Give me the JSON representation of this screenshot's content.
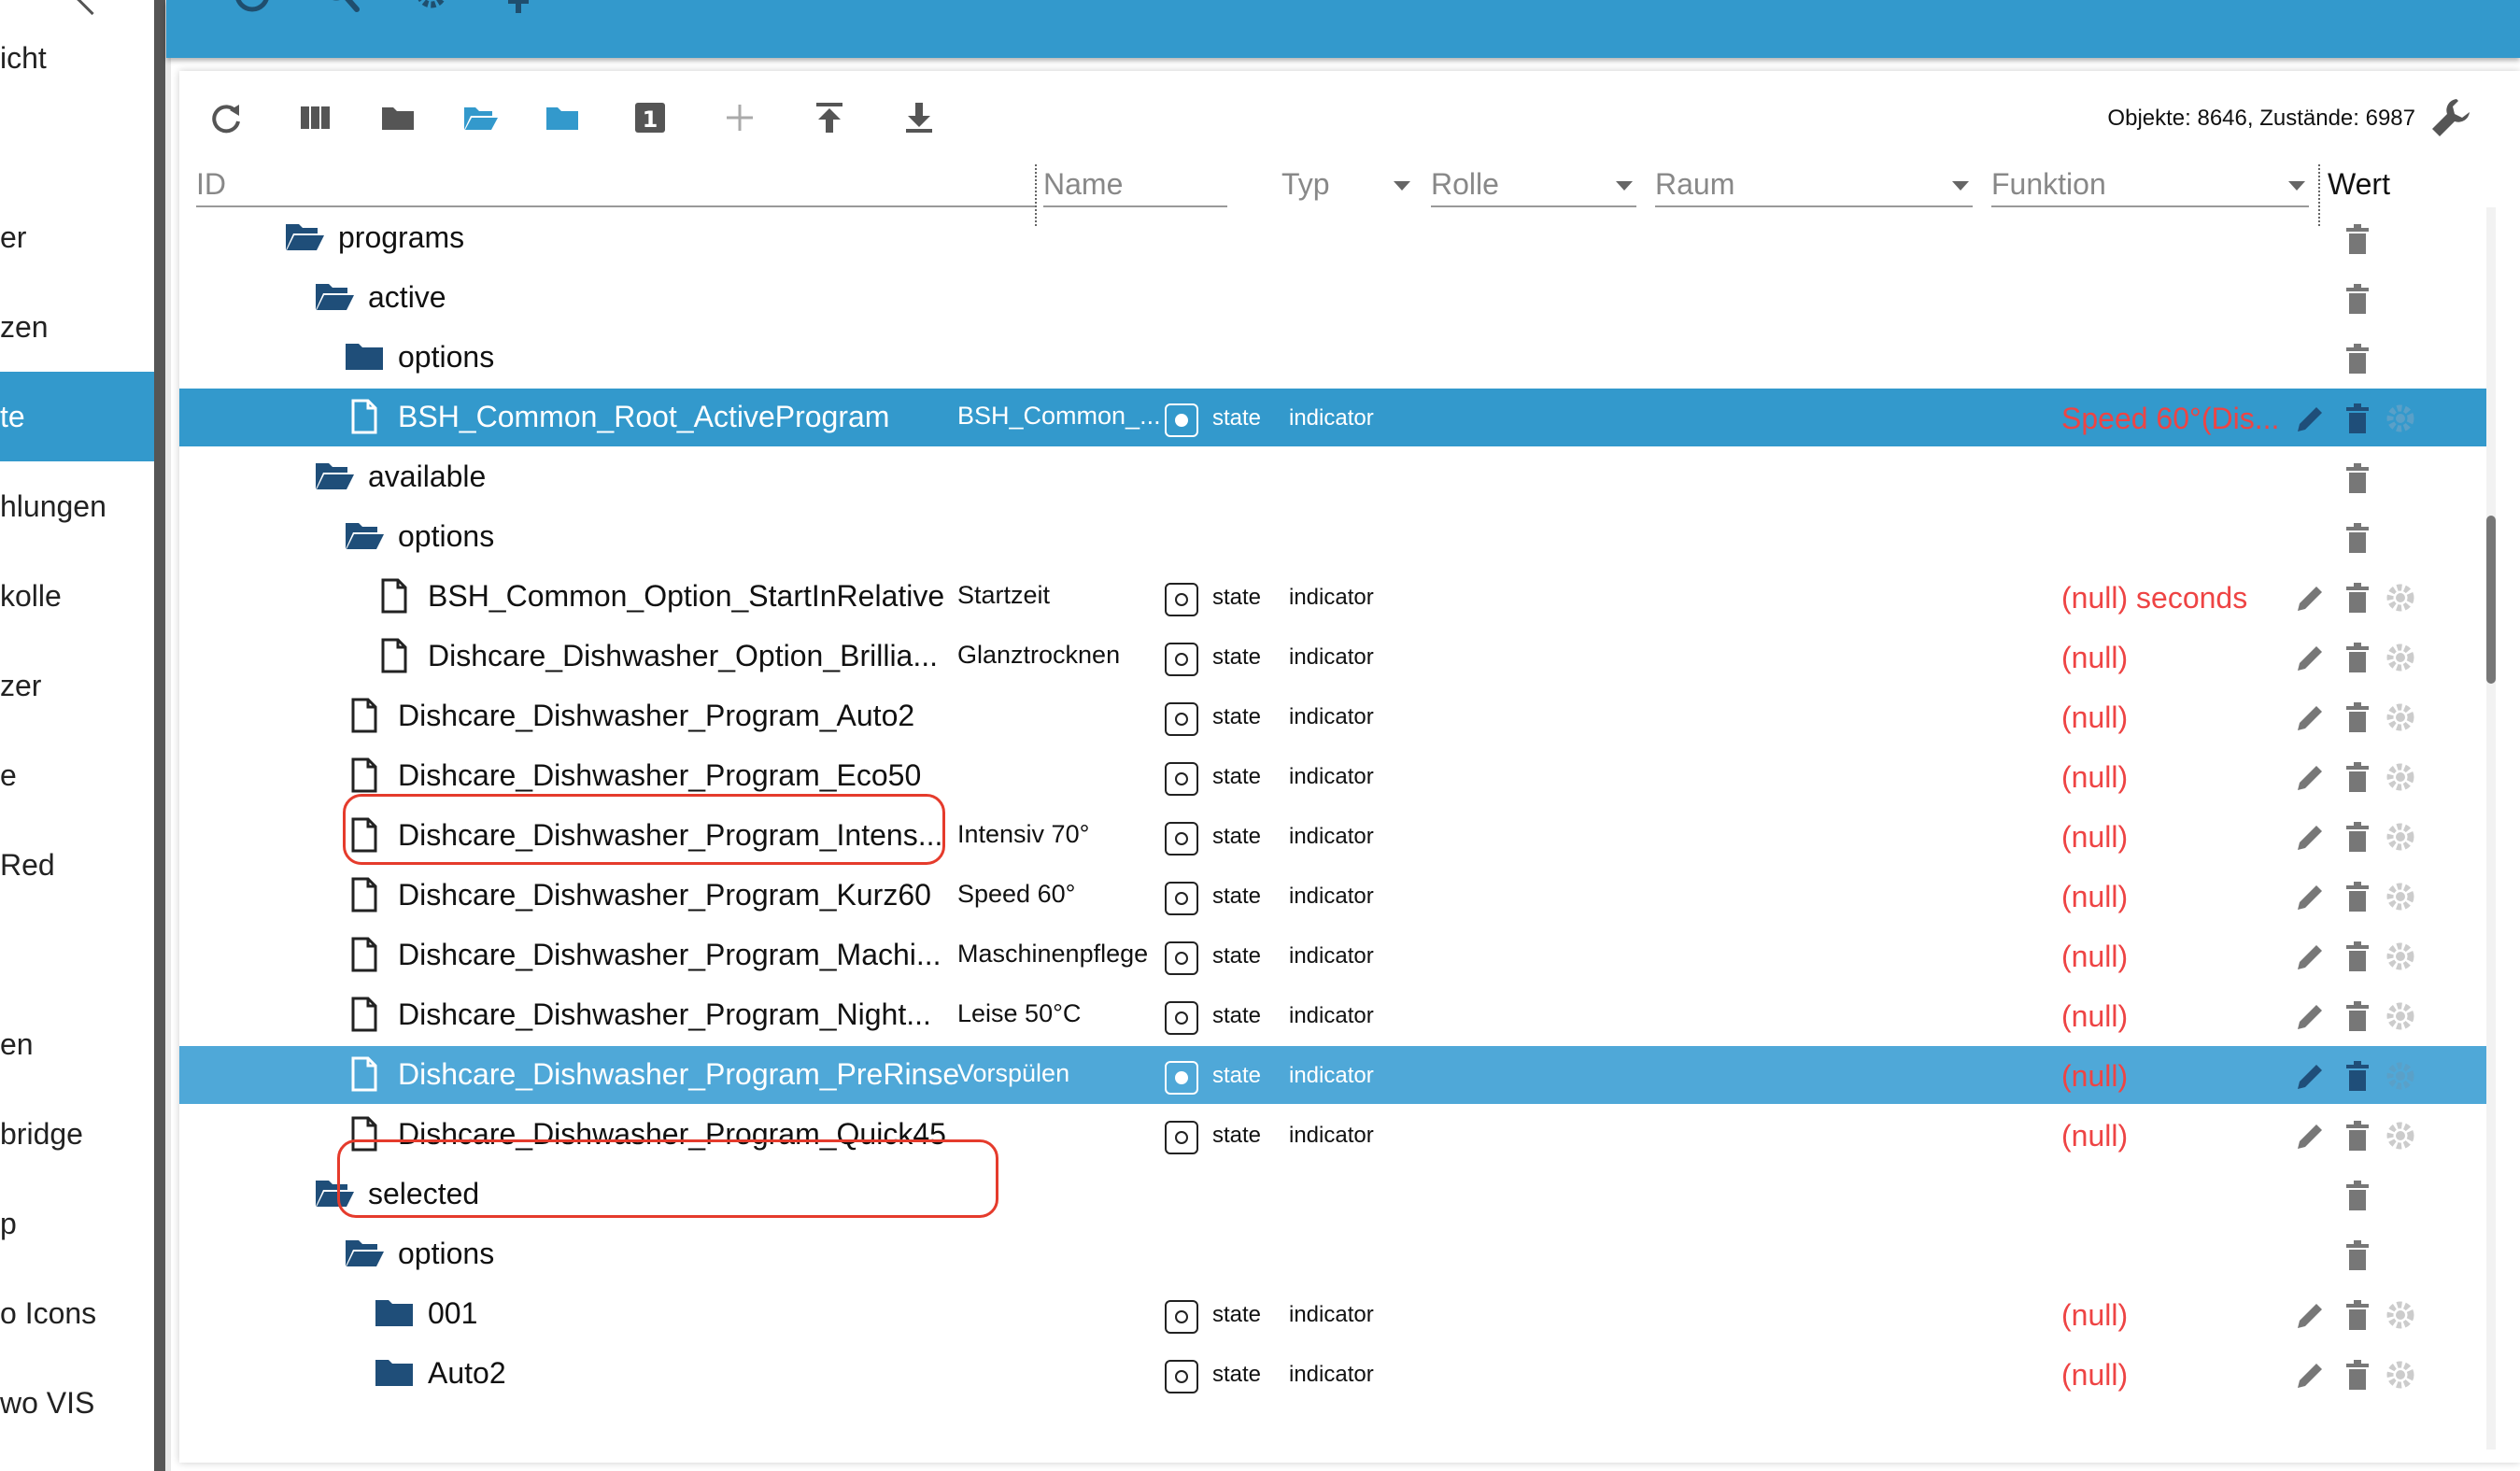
{
  "sidebar": {
    "items": [
      {
        "label": "icht",
        "active": false
      },
      {
        "label": "er",
        "active": false
      },
      {
        "label": "zen",
        "active": false
      },
      {
        "label": "te",
        "active": true
      },
      {
        "label": "hlungen",
        "active": false
      },
      {
        "label": "kolle",
        "active": false
      },
      {
        "label": "zer",
        "active": false
      },
      {
        "label": "e",
        "active": false
      },
      {
        "label": "Red",
        "active": false
      },
      {
        "label": "en",
        "active": false
      },
      {
        "label": "bridge",
        "active": false
      },
      {
        "label": "p",
        "active": false
      },
      {
        "label": "o Icons",
        "active": false
      },
      {
        "label": "wo VIS",
        "active": false
      }
    ]
  },
  "toolbar": {
    "counts": "Objekte: 8646, Zustände: 6987",
    "buttons": [
      "refresh-icon",
      "columns-icon",
      "folder-icon",
      "folder-open-icon",
      "folder-filled-icon",
      "number-one-icon",
      "add-icon",
      "upload-icon",
      "download-icon"
    ],
    "number_badge": "1"
  },
  "columns": {
    "id": "ID",
    "name": "Name",
    "typ": "Typ",
    "rolle": "Rolle",
    "raum": "Raum",
    "funktion": "Funktion",
    "wert": "Wert"
  },
  "rows": [
    {
      "icon": "folder-open",
      "indent": 1,
      "id": "programs",
      "name": "",
      "type": "",
      "role": "",
      "value": "",
      "actions": "delete"
    },
    {
      "icon": "folder-open",
      "indent": 2,
      "id": "active",
      "name": "",
      "type": "",
      "role": "",
      "value": "",
      "actions": "delete"
    },
    {
      "icon": "folder",
      "indent": 3,
      "id": "options",
      "name": "",
      "type": "",
      "role": "",
      "value": "",
      "actions": "delete"
    },
    {
      "icon": "file",
      "indent": 3,
      "id": "BSH_Common_Root_ActiveProgram",
      "name": "BSH_Common_...",
      "type": "state",
      "role": "indicator",
      "value": "Speed 60°(Dis...",
      "actions": "all",
      "selected": "sel",
      "typ_filled": true
    },
    {
      "icon": "folder-open",
      "indent": 2,
      "id": "available",
      "name": "",
      "type": "",
      "role": "",
      "value": "",
      "actions": "delete"
    },
    {
      "icon": "folder-open",
      "indent": 3,
      "id": "options",
      "name": "",
      "type": "",
      "role": "",
      "value": "",
      "actions": "delete"
    },
    {
      "icon": "file",
      "indent": 4,
      "id": "BSH_Common_Option_StartInRelative",
      "name": "Startzeit",
      "type": "state",
      "role": "indicator",
      "value": "(null) seconds",
      "actions": "all"
    },
    {
      "icon": "file",
      "indent": 4,
      "id": "Dishcare_Dishwasher_Option_Brillia...",
      "name": "Glanztrocknen",
      "type": "state",
      "role": "indicator",
      "value": "(null)",
      "actions": "all"
    },
    {
      "icon": "file",
      "indent": 3,
      "id": "Dishcare_Dishwasher_Program_Auto2",
      "name": "",
      "type": "state",
      "role": "indicator",
      "value": "(null)",
      "actions": "all"
    },
    {
      "icon": "file",
      "indent": 3,
      "id": "Dishcare_Dishwasher_Program_Eco50",
      "name": "",
      "type": "state",
      "role": "indicator",
      "value": "(null)",
      "actions": "all",
      "highlight": "eco"
    },
    {
      "icon": "file",
      "indent": 3,
      "id": "Dishcare_Dishwasher_Program_Intens...",
      "name": "Intensiv 70°",
      "type": "state",
      "role": "indicator",
      "value": "(null)",
      "actions": "all"
    },
    {
      "icon": "file",
      "indent": 3,
      "id": "Dishcare_Dishwasher_Program_Kurz60",
      "name": "Speed 60°",
      "type": "state",
      "role": "indicator",
      "value": "(null)",
      "actions": "all"
    },
    {
      "icon": "file",
      "indent": 3,
      "id": "Dishcare_Dishwasher_Program_Machi...",
      "name": "Maschinenpflege",
      "type": "state",
      "role": "indicator",
      "value": "(null)",
      "actions": "all"
    },
    {
      "icon": "file",
      "indent": 3,
      "id": "Dishcare_Dishwasher_Program_Night...",
      "name": "Leise 50°C",
      "type": "state",
      "role": "indicator",
      "value": "(null)",
      "actions": "all"
    },
    {
      "icon": "file",
      "indent": 3,
      "id": "Dishcare_Dishwasher_Program_PreRinse",
      "name": "Vorspülen",
      "type": "state",
      "role": "indicator",
      "value": "(null)",
      "actions": "all",
      "selected": "sel2",
      "typ_filled": true
    },
    {
      "icon": "file",
      "indent": 3,
      "id": "Dishcare_Dishwasher_Program_Quick45",
      "name": "",
      "type": "state",
      "role": "indicator",
      "value": "(null)",
      "actions": "all",
      "highlight": "quick"
    },
    {
      "icon": "folder-open",
      "indent": 2,
      "id": "selected",
      "name": "",
      "type": "",
      "role": "",
      "value": "",
      "actions": "delete"
    },
    {
      "icon": "folder-open",
      "indent": 3,
      "id": "options",
      "name": "",
      "type": "",
      "role": "",
      "value": "",
      "actions": "delete"
    },
    {
      "icon": "folder",
      "indent": 4,
      "id": "001",
      "name": "",
      "type": "state",
      "role": "indicator",
      "value": "(null)",
      "actions": "all"
    },
    {
      "icon": "folder",
      "indent": 4,
      "id": "Auto2",
      "name": "",
      "type": "state",
      "role": "indicator",
      "value": "(null)",
      "actions": "all"
    }
  ],
  "colors": {
    "accent": "#3399cc",
    "folder": "#1f4e79",
    "value_red": "#ee4444",
    "highlight_red": "#e53b2c"
  }
}
